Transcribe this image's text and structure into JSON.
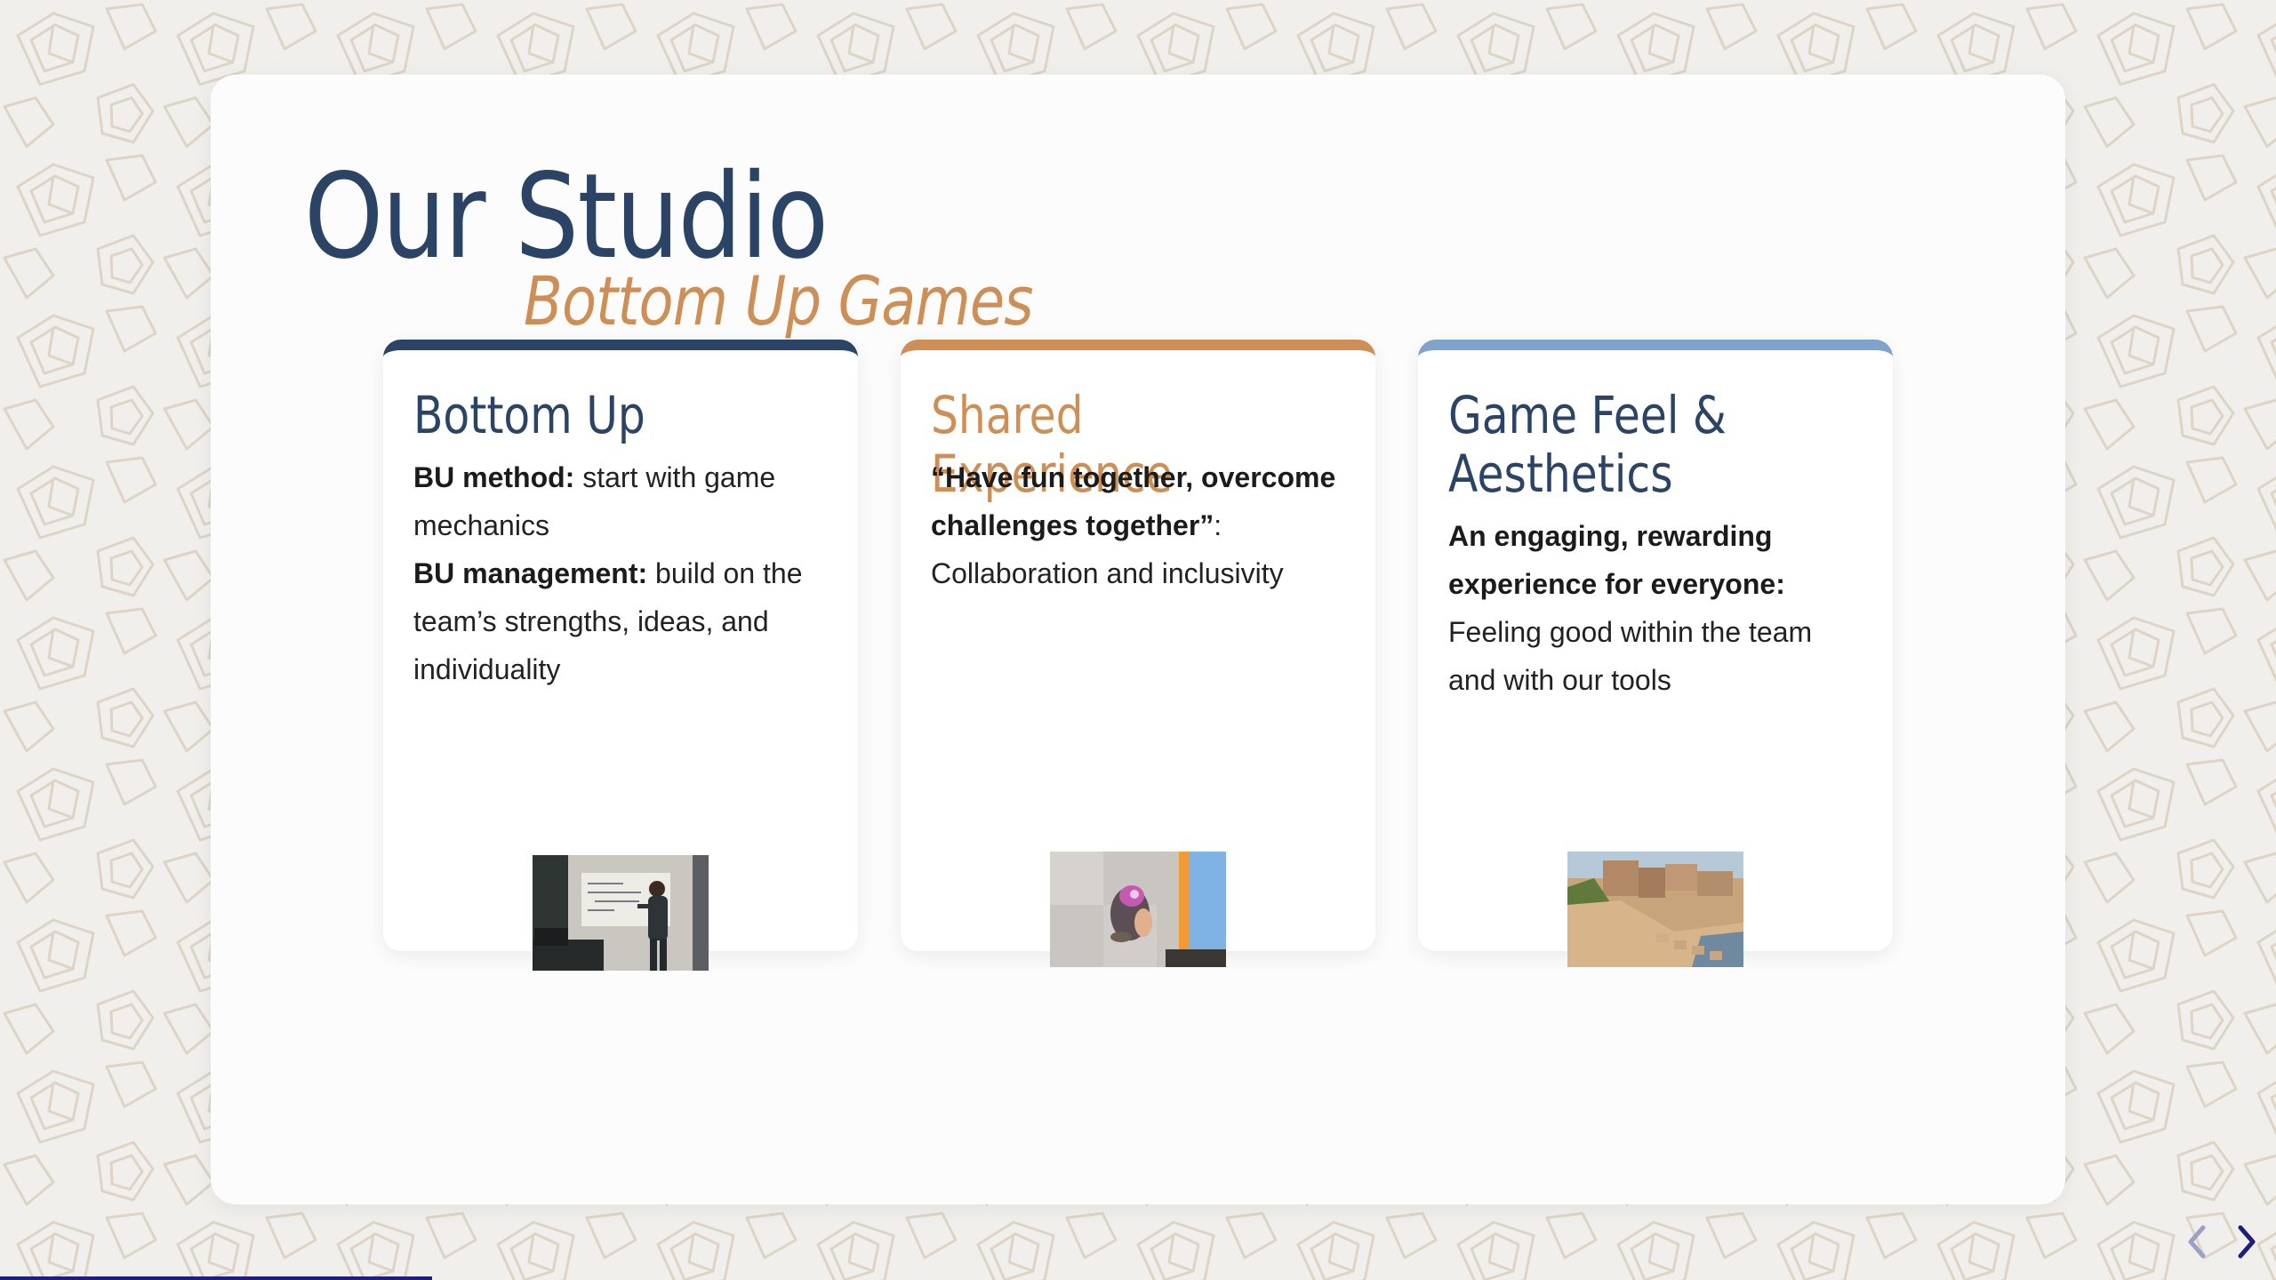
{
  "colors": {
    "background": "#f0efec",
    "pattern_stroke": "#ddd4c6",
    "slide_bg": "#fcfcfc",
    "title": "#2b4466",
    "accent_orange": "#cd8f56",
    "accent_navy": "#2b4466",
    "accent_blue": "#7fa4cb",
    "nav_arrow": "#1d1f7a",
    "nav_arrow_disabled": "#9aa1c4"
  },
  "slide": {
    "title": "Our Studio",
    "subtitle": "Bottom Up Games"
  },
  "cards": [
    {
      "title": "Bottom Up",
      "title_color": "#2b4466",
      "accent": "#2b4466",
      "paragraphs": [
        {
          "bold": "BU method:",
          "text": " start with game mechanics"
        },
        {
          "bold": "BU management:",
          "text": " build on the team’s strengths, ideas, and individuality"
        }
      ],
      "image_icon": "team-whiteboard-photo"
    },
    {
      "title": "Shared Experience",
      "title_color": "#cd8f56",
      "accent": "#cd8f56",
      "paragraphs": [
        {
          "bold": "“Have fun together, overcome challenges together”",
          "text": ": Collaboration and inclusivity"
        }
      ],
      "image_icon": "game-character-screenshot"
    },
    {
      "title": "Game Feel & Aesthetics",
      "title_color": "#2b4466",
      "accent": "#7fa4cb",
      "paragraphs": [
        {
          "bold": "An engaging, rewarding experience for everyone:",
          "text": " Feeling good within the team and with our tools"
        }
      ],
      "image_icon": "desert-landscape-screenshot"
    }
  ],
  "navigation": {
    "prev_icon": "chevron-left-icon",
    "next_icon": "chevron-right-icon",
    "progress": 0.19
  }
}
